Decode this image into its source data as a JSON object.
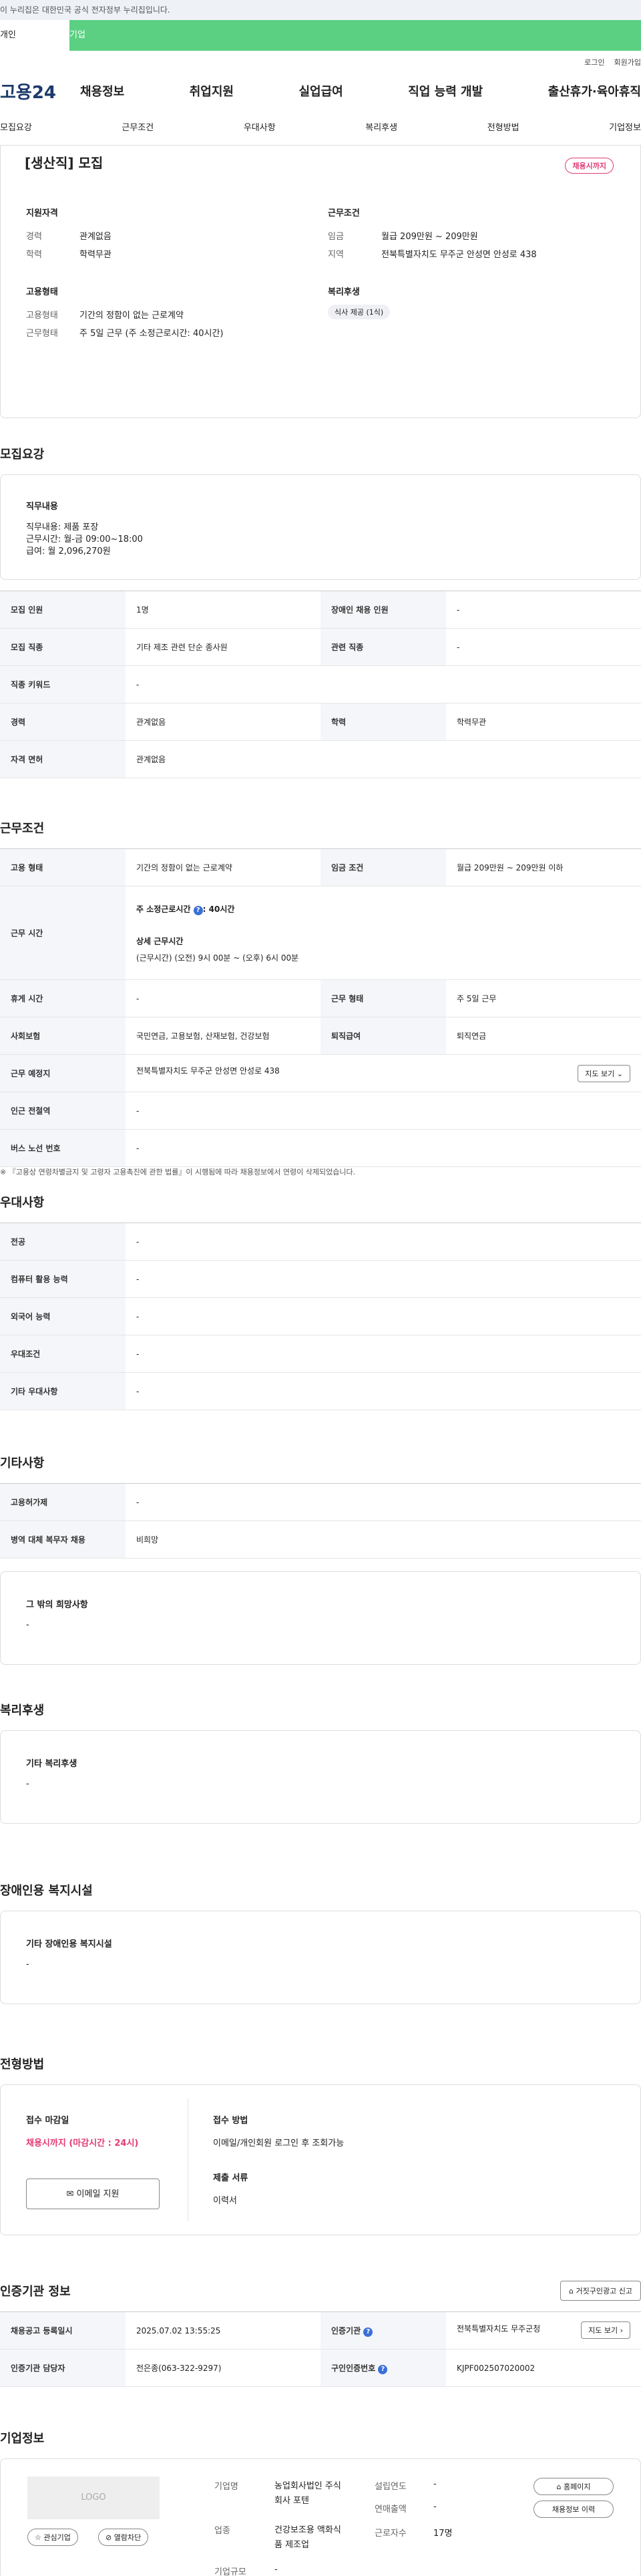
{
  "notice": "이 누리집은 대한민국 공식 전자정부 누리집입니다.",
  "topbar": {
    "tab1": "개인",
    "tab2": "기업"
  },
  "utils": {
    "login": "로그인",
    "join": "회원가입"
  },
  "gnb": {
    "logo": "고용24",
    "menu": [
      "채용정보",
      "취업지원",
      "실업급여",
      "직업 능력 개발",
      "출산휴가·육아휴직"
    ]
  },
  "tabs": [
    "모집요강",
    "근무조건",
    "우대사항",
    "복리후생",
    "전형방법",
    "기업정보"
  ],
  "job": {
    "title": "[생산직] 모집",
    "status_badge": "채용시까지",
    "req_head": "지원자격",
    "career_k": "경력",
    "career_v": "관계없음",
    "edu_k": "학력",
    "edu_v": "학력무관",
    "cond_head": "근무조건",
    "wage_k": "임금",
    "wage_v": "월급 209만원 ~ 209만원",
    "area_k": "지역",
    "area_v": "전북특별자치도 무주군 안성면 안성로 438",
    "emp_head": "고용형태",
    "etype_k": "고용형태",
    "etype_v": "기간의 정함이 없는 근로계약",
    "wtype_k": "근무형태",
    "wtype_v": "주 5일 근무 (주 소정근로시간: 40시간)",
    "benefit_head": "복리후생",
    "benefit_tag": "식사 제공 (1식)"
  },
  "recruit": {
    "heading": "모집요강",
    "duty_head": "직무내용",
    "duty_lines": [
      "직무내용: 제품 포장",
      "근무시간: 월-금 09:00~18:00",
      "급여: 월 2,096,270원"
    ],
    "rows": [
      [
        "모집 인원",
        "1명",
        "장애인 채용 인원",
        "-"
      ],
      [
        "모집 직종",
        "기타 제조 관련 단순 종사원",
        "관련 직종",
        "-"
      ],
      [
        "직종 키워드",
        "-",
        "",
        ""
      ],
      [
        "경력",
        "관계없음",
        "학력",
        "학력무관"
      ],
      [
        "자격 면허",
        "관계없음",
        "",
        ""
      ]
    ]
  },
  "work": {
    "heading": "근무조건",
    "r1": [
      "고용 형태",
      "기간의 정함이 없는 근로계약",
      "임금 조건",
      "월급 209만원 ~ 209만원 이하"
    ],
    "time_k": "근무 시간",
    "time_a": "주 소정근로시간",
    "time_a_v": ": 40시간",
    "time_b": "상세 근무시간",
    "time_b_v": "(근무시간) (오전) 9시 00분 ~ (오후) 6시 00분",
    "r3": [
      "휴게 시간",
      "-",
      "근무 형태",
      "주 5일 근무"
    ],
    "r4": [
      "사회보험",
      "국민연금, 고용보험, 산재보험, 건강보험",
      "퇴직급여",
      "퇴직연금"
    ],
    "place_k": "근무 예정지",
    "place_v": "전북특별자치도 무주군 안성면 안성로 438",
    "map_btn": "지도 보기",
    "r6": [
      "인근 전철역",
      "-"
    ],
    "r7": [
      "버스 노선 번호",
      "-"
    ],
    "footnote": "※ 『고용상 연령차별금지 및 고령자 고용촉진에 관한 법률』이 시행됨에 따라 채용정보에서 연령이 삭제되었습니다."
  },
  "pref": {
    "heading": "우대사항",
    "rows": [
      [
        "전공",
        "-"
      ],
      [
        "컴퓨터 활용 능력",
        "-"
      ],
      [
        "외국어 능력",
        "-"
      ],
      [
        "우대조건",
        "-"
      ],
      [
        "기타 우대사항",
        "-"
      ]
    ]
  },
  "etc": {
    "heading": "기타사항",
    "rows": [
      [
        "고용허가제",
        "-"
      ],
      [
        "병역 대체 복무자 채용",
        "비희망"
      ]
    ],
    "wish_head": "그 밖의 희망사항",
    "wish_v": "-"
  },
  "welfare": {
    "heading": "복리후생",
    "sub": "기타 복리후생",
    "v": "-"
  },
  "disabled": {
    "heading": "장애인용 복지시설",
    "sub": "기타 장애인용 복지시설",
    "v": "-"
  },
  "selection": {
    "heading": "전형방법",
    "deadline_k": "접수 마감일",
    "deadline_v": "채용시까지 (마감시간 : 24시)",
    "method_k": "접수 방법",
    "method_v": "이메일/개인회원 로그인 후 조회가능",
    "email_btn": "이메일 지원",
    "docs_k": "제출 서류",
    "docs_v": "이력서"
  },
  "cert": {
    "heading": "인증기관 정보",
    "report_btn": "거짓구인광고 신고",
    "r1": [
      "채용공고 등록일시",
      "2025.07.02 13:55:25",
      "인증기관",
      "전북특별자치도 무주군청"
    ],
    "map_btn": "지도 보기",
    "r2": [
      "인증기관 담당자",
      "전은종(063-322-9297)",
      "구인인증번호",
      "KJPF002507020002"
    ]
  },
  "company": {
    "heading": "기업정보",
    "logo": "LOGO",
    "fav_btn": "관심기업",
    "block_btn": "열람차단",
    "name_k": "기업명",
    "name_v": "농업회사법인 주식회사 포텐",
    "ind_k": "업종",
    "ind_v": "건강보조용 액화식품 제조업",
    "size_k": "기업규모",
    "size_v": "-",
    "est_k": "설립연도",
    "est_v": "-",
    "rev_k": "연매출액",
    "rev_v": "-",
    "emp_k": "근로자수",
    "emp_v": "17명",
    "home_btn": "홈페이지",
    "hist_btn": "채용정보 이력"
  },
  "colors": {
    "brand_green": "#5bd082",
    "badge_pink": "#e23a75",
    "th_bg": "#f4f6f9"
  }
}
